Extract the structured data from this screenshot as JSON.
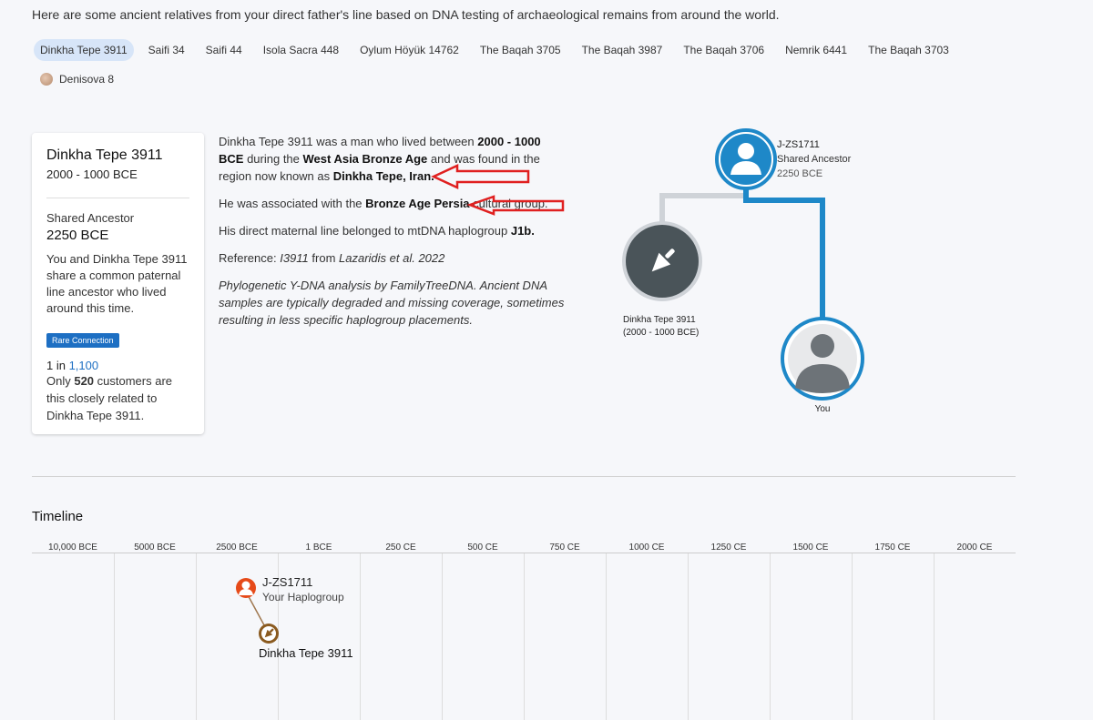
{
  "intro": "Here are some ancient relatives from your direct father's line based on DNA testing of archaeological remains from around the world.",
  "chips": [
    {
      "label": "Dinkha Tepe 3911",
      "selected": true
    },
    {
      "label": "Saifi 34"
    },
    {
      "label": "Saifi 44"
    },
    {
      "label": "Isola Sacra 448"
    },
    {
      "label": "Oylum Höyük 14762"
    },
    {
      "label": "The Baqah 3705"
    },
    {
      "label": "The Baqah 3987"
    },
    {
      "label": "The Baqah 3706"
    },
    {
      "label": "Nemrik 6441"
    },
    {
      "label": "The Baqah 3703"
    },
    {
      "label": "Denisova 8",
      "thumb": true
    }
  ],
  "card": {
    "name": "Dinkha Tepe 3911",
    "dates": "2000 - 1000 BCE",
    "shared_label": "Shared Ancestor",
    "shared_date": "2250 BCE",
    "desc": "You and Dinkha Tepe 3911 share a common paternal line ancestor who lived around this time.",
    "badge": "Rare Connection",
    "ratio_prefix": "1 in ",
    "ratio_value": "1,100",
    "only_prefix": "Only ",
    "only_count": "520",
    "only_suffix": " customers are this closely related to Dinkha Tepe 3911."
  },
  "main": {
    "p1_a": "Dinkha Tepe 3911 was a man who lived between ",
    "p1_b": "2000 - 1000 BCE",
    "p1_c": " during the ",
    "p1_d": "West Asia Bronze Age",
    "p1_e": " and was found in the region now known as ",
    "p1_f": "Dinkha Tepe, Iran.",
    "p2_a": "He was associated with the ",
    "p2_b": "Bronze Age Persia",
    "p2_c": " cultural group.",
    "p3_a": "His direct maternal line belonged to mtDNA haplogroup ",
    "p3_b": "J1b.",
    "p4_a": "Reference: ",
    "p4_b": "I3911",
    "p4_c": " from ",
    "p4_d": "Lazaridis et al. 2022",
    "p5": "Phylogenetic Y-DNA analysis by FamilyTreeDNA. Ancient DNA samples are typically degraded and missing coverage, sometimes resulting in less specific haplogroup placements."
  },
  "tree": {
    "haplogroup": "J-ZS1711",
    "shared_label": "Shared Ancestor",
    "shared_date": "2250 BCE",
    "ancient_name": "Dinkha Tepe 3911",
    "ancient_dates": "(2000 - 1000 BCE)",
    "you_label": "You",
    "colors": {
      "blue": "#1e88c8",
      "gray": "#cfd3d8",
      "dark": "#4a5459"
    }
  },
  "timeline": {
    "title": "Timeline",
    "ticks": [
      "10,000 BCE",
      "5000 BCE",
      "2500 BCE",
      "1 BCE",
      "250 CE",
      "500 CE",
      "750 CE",
      "1000 CE",
      "1250 CE",
      "1500 CE",
      "1750 CE",
      "2000 CE"
    ],
    "haplogroup": "J-ZS1711",
    "haplogroup_sub": "Your Haplogroup",
    "ancient_name": "Dinkha Tepe 3911"
  }
}
